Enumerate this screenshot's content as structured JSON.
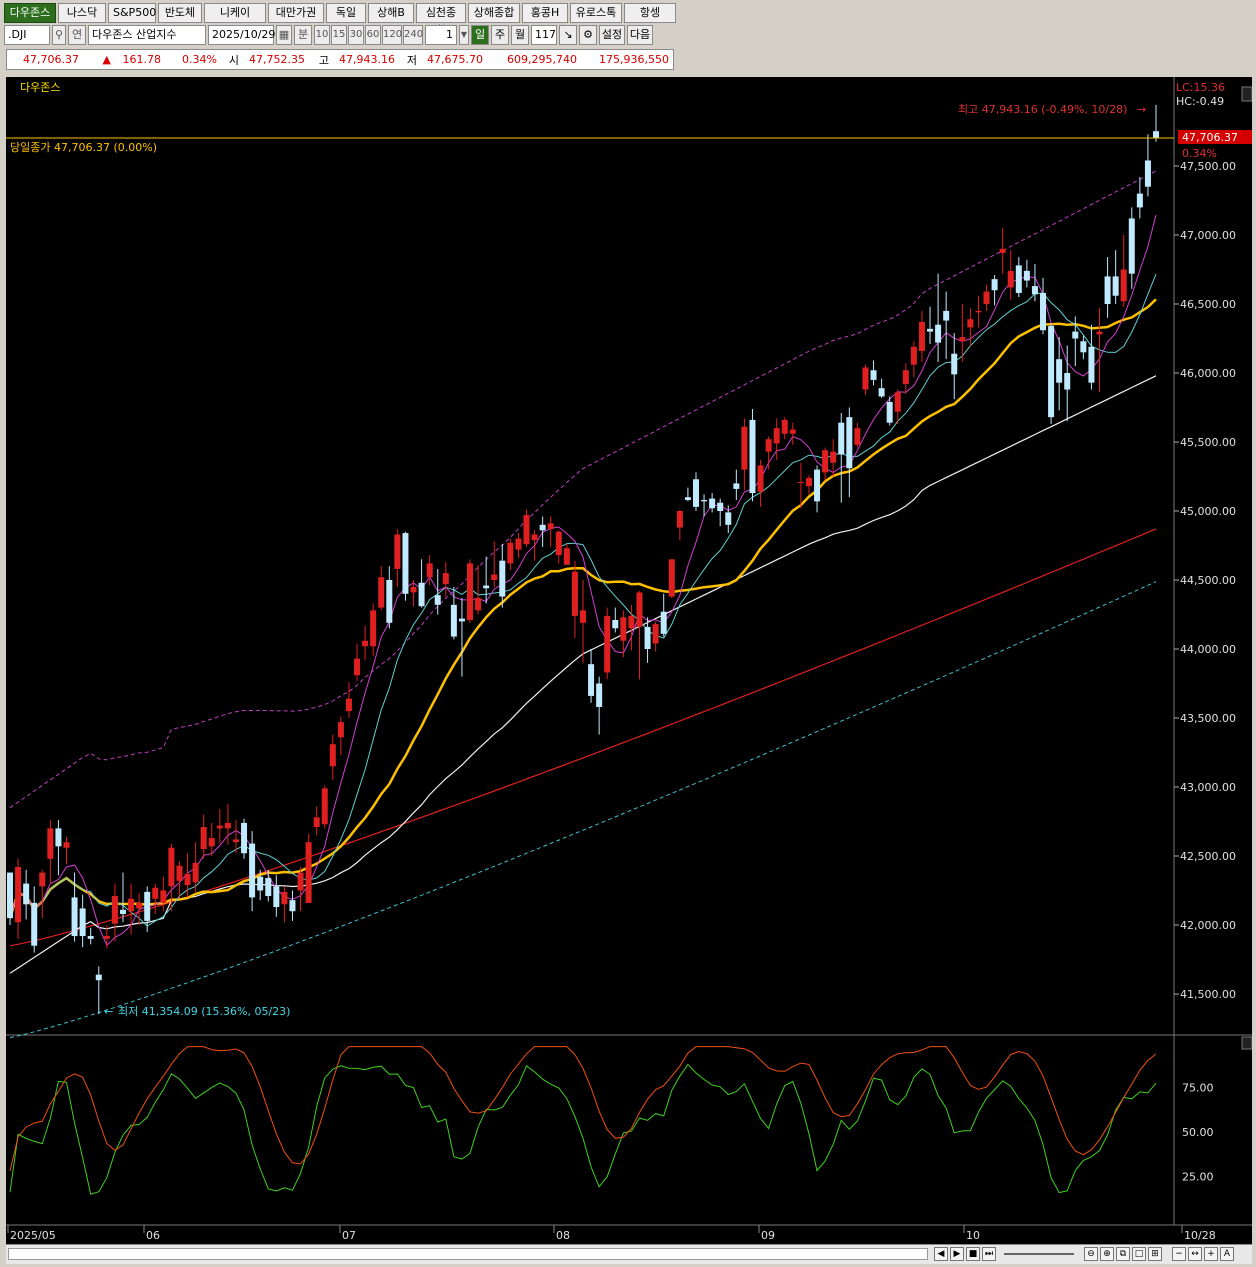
{
  "tabs": [
    "다우존스",
    "나스닥",
    "S&P500",
    "반도체",
    "니케이",
    "대만가권",
    "독일",
    "상해B",
    "심천종합",
    "상해종합",
    "홍콩H",
    "유로스톡",
    "항셍"
  ],
  "toolbar": {
    "code": ".DJI",
    "code_type": "연",
    "name": "다우존스 산업지수",
    "date": "2025/10/29",
    "period_unit": "분",
    "minute_options": [
      "10",
      "15",
      "30",
      "60",
      "120",
      "240"
    ],
    "count_value": "1",
    "day_btn": "일",
    "week_btn": "주",
    "month_btn": "월",
    "bars": "117",
    "settings": "설정",
    "next": "다음"
  },
  "quote": {
    "price": "47,706.37",
    "arrow": "▲",
    "change": "161.78",
    "pct": "0.34%",
    "open_label": "시",
    "open": "47,752.35",
    "high_label": "고",
    "high": "47,943.16",
    "low_label": "저",
    "low": "47,675.70",
    "volume": "609,295,740",
    "amount": "175,936,550"
  },
  "chart": {
    "title": "다우존스",
    "prev_close_label": "당일종가 47,706.37 (0.00%)",
    "max_label": "최고 47,943.16 (-0.49%, 10/28)",
    "min_label": "최저 41,354.09 (15.36%, 05/23)",
    "lc": "LC:15.36",
    "hc": "HC:-0.49",
    "price_box": "47,706.37",
    "price_box_pct": "0.34%",
    "y_ticks": [
      "47,500.00",
      "47,000.00",
      "46,500.00",
      "46,000.00",
      "45,500.00",
      "45,000.00",
      "44,500.00",
      "44,000.00",
      "43,500.00",
      "43,000.00",
      "42,500.00",
      "42,000.00",
      "41,500.00"
    ],
    "osc_ticks": [
      "75.00",
      "50.00",
      "25.00"
    ],
    "x_labels": [
      "2025/05",
      "06",
      "07",
      "08",
      "09",
      "10",
      "10/28"
    ]
  },
  "chart_data": {
    "type": "candlestick",
    "y_range": [
      41200,
      48000
    ],
    "osc_range": [
      0,
      100
    ],
    "candles": [
      [
        42380,
        42380,
        42000,
        42050
      ],
      [
        42020,
        42480,
        41900,
        42420
      ],
      [
        42300,
        42400,
        42040,
        42150
      ],
      [
        42160,
        42280,
        41800,
        41850
      ],
      [
        42280,
        42400,
        42050,
        42380
      ],
      [
        42480,
        42760,
        42300,
        42700
      ],
      [
        42700,
        42760,
        42360,
        42570
      ],
      [
        42560,
        42640,
        42440,
        42600
      ],
      [
        42200,
        42380,
        41880,
        41920
      ],
      [
        42120,
        42220,
        41840,
        41920
      ],
      [
        41920,
        41980,
        41860,
        41900
      ],
      [
        41640,
        41700,
        41354,
        41600
      ],
      [
        41900,
        42000,
        41830,
        41920
      ],
      [
        42010,
        42300,
        41880,
        42210
      ],
      [
        42110,
        42380,
        42020,
        42080
      ],
      [
        42100,
        42300,
        41930,
        42190
      ],
      [
        42120,
        42230,
        42000,
        42160
      ],
      [
        42240,
        42280,
        41950,
        42030
      ],
      [
        42190,
        42300,
        42080,
        42270
      ],
      [
        42160,
        42350,
        42100,
        42250
      ],
      [
        42280,
        42590,
        42100,
        42560
      ],
      [
        42320,
        42460,
        42190,
        42430
      ],
      [
        42290,
        42520,
        42200,
        42370
      ],
      [
        42310,
        42600,
        42240,
        42450
      ],
      [
        42550,
        42800,
        42480,
        42710
      ],
      [
        42570,
        42740,
        42500,
        42630
      ],
      [
        42700,
        42840,
        42590,
        42720
      ],
      [
        42700,
        42880,
        42580,
        42740
      ],
      [
        42600,
        42760,
        42520,
        42620
      ],
      [
        42740,
        42770,
        42480,
        42520
      ],
      [
        42590,
        42680,
        42100,
        42200
      ],
      [
        42350,
        42400,
        42180,
        42250
      ],
      [
        42340,
        42400,
        42170,
        42210
      ],
      [
        42280,
        42360,
        42060,
        42130
      ],
      [
        42150,
        42280,
        42020,
        42240
      ],
      [
        42180,
        42250,
        42030,
        42100
      ],
      [
        42250,
        42420,
        42100,
        42380
      ],
      [
        42160,
        42660,
        42160,
        42600
      ],
      [
        42710,
        42860,
        42650,
        42780
      ],
      [
        42730,
        43010,
        42700,
        42990
      ],
      [
        43150,
        43380,
        43050,
        43310
      ],
      [
        43360,
        43510,
        43230,
        43470
      ],
      [
        43550,
        43760,
        43500,
        43640
      ],
      [
        43810,
        44040,
        43770,
        43930
      ],
      [
        44020,
        44170,
        43920,
        44060
      ],
      [
        44020,
        44330,
        43950,
        44280
      ],
      [
        44300,
        44600,
        44280,
        44520
      ],
      [
        44500,
        44600,
        44150,
        44190
      ],
      [
        44580,
        44870,
        44450,
        44830
      ],
      [
        44840,
        44850,
        44350,
        44400
      ],
      [
        44410,
        44500,
        44310,
        44450
      ],
      [
        44480,
        44650,
        44300,
        44310
      ],
      [
        44520,
        44680,
        44460,
        44620
      ],
      [
        44390,
        44580,
        44250,
        44320
      ],
      [
        44470,
        44630,
        44380,
        44550
      ],
      [
        44320,
        44450,
        44070,
        44090
      ],
      [
        44220,
        44370,
        43800,
        44200
      ],
      [
        44210,
        44650,
        44190,
        44620
      ],
      [
        44280,
        44610,
        44250,
        44370
      ],
      [
        44460,
        44670,
        44330,
        44440
      ],
      [
        44500,
        44780,
        44450,
        44540
      ],
      [
        44640,
        44760,
        44300,
        44380
      ],
      [
        44620,
        44800,
        44570,
        44770
      ],
      [
        44720,
        44840,
        44660,
        44800
      ],
      [
        44760,
        45010,
        44740,
        44970
      ],
      [
        44790,
        44860,
        44640,
        44830
      ],
      [
        44900,
        44960,
        44740,
        44860
      ],
      [
        44870,
        44960,
        44740,
        44910
      ],
      [
        44680,
        44860,
        44620,
        44850
      ],
      [
        44610,
        44760,
        44660,
        44730
      ],
      [
        44240,
        44640,
        44080,
        44560
      ],
      [
        44190,
        44500,
        43900,
        44280
      ],
      [
        43890,
        44000,
        43610,
        43660
      ],
      [
        43750,
        43800,
        43380,
        43580
      ],
      [
        43830,
        44300,
        43780,
        44240
      ],
      [
        44210,
        44300,
        44120,
        44150
      ],
      [
        44060,
        44280,
        43940,
        44230
      ],
      [
        44150,
        44320,
        43990,
        44240
      ],
      [
        44160,
        44420,
        43780,
        44410
      ],
      [
        44160,
        44230,
        43900,
        44000
      ],
      [
        44040,
        44200,
        43980,
        44180
      ],
      [
        44270,
        44400,
        44090,
        44110
      ],
      [
        44380,
        44650,
        44370,
        44650
      ],
      [
        44880,
        45010,
        44790,
        45000
      ],
      [
        45100,
        45170,
        45070,
        45080
      ],
      [
        45230,
        45280,
        45000,
        45030
      ],
      [
        45080,
        45120,
        44960,
        45070
      ],
      [
        45090,
        45130,
        44990,
        45020
      ],
      [
        45060,
        45090,
        44890,
        45000
      ],
      [
        44990,
        45040,
        44840,
        44900
      ],
      [
        45200,
        45300,
        45080,
        45160
      ],
      [
        45300,
        45670,
        45150,
        45610
      ],
      [
        45660,
        45740,
        45070,
        45130
      ],
      [
        45140,
        45370,
        45030,
        45330
      ],
      [
        45430,
        45540,
        45300,
        45520
      ],
      [
        45490,
        45670,
        45370,
        45600
      ],
      [
        45560,
        45680,
        45520,
        45660
      ],
      [
        45560,
        45640,
        45480,
        45590
      ],
      [
        45210,
        45350,
        45020,
        45210
      ],
      [
        45180,
        45260,
        45120,
        45240
      ],
      [
        45300,
        45330,
        44990,
        45070
      ],
      [
        45280,
        45460,
        45220,
        45440
      ],
      [
        45350,
        45520,
        45250,
        45430
      ],
      [
        45640,
        45710,
        45060,
        45410
      ],
      [
        45680,
        45750,
        45100,
        45310
      ],
      [
        45480,
        45640,
        45460,
        45600
      ],
      [
        45880,
        46060,
        45840,
        46040
      ],
      [
        46020,
        46090,
        45910,
        45950
      ],
      [
        45890,
        45960,
        45820,
        45830
      ],
      [
        45790,
        45830,
        45620,
        45640
      ],
      [
        45720,
        45880,
        45630,
        45860
      ],
      [
        45920,
        46070,
        45850,
        46020
      ],
      [
        46060,
        46230,
        45970,
        46190
      ],
      [
        46160,
        46450,
        46080,
        46370
      ],
      [
        46320,
        46480,
        46210,
        46300
      ],
      [
        46350,
        46720,
        46080,
        46220
      ],
      [
        46450,
        46590,
        46100,
        46380
      ],
      [
        46140,
        46290,
        45810,
        45990
      ],
      [
        46230,
        46500,
        46080,
        46260
      ],
      [
        46330,
        46470,
        46190,
        46390
      ],
      [
        46440,
        46560,
        46330,
        46450
      ],
      [
        46500,
        46640,
        46450,
        46590
      ],
      [
        46680,
        46710,
        46490,
        46600
      ],
      [
        46870,
        47050,
        46720,
        46900
      ],
      [
        46620,
        46890,
        46530,
        46740
      ],
      [
        46780,
        46840,
        46550,
        46580
      ],
      [
        46740,
        46820,
        46620,
        46670
      ],
      [
        46630,
        46790,
        46520,
        46570
      ],
      [
        46580,
        46690,
        46280,
        46310
      ],
      [
        46340,
        46360,
        45630,
        45680
      ],
      [
        46100,
        46260,
        45730,
        45930
      ],
      [
        46000,
        46200,
        45650,
        45880
      ],
      [
        46300,
        46410,
        46050,
        46250
      ],
      [
        46230,
        46270,
        46100,
        46150
      ],
      [
        46190,
        46350,
        45880,
        45930
      ],
      [
        46280,
        46470,
        45860,
        46300
      ],
      [
        46700,
        46840,
        46400,
        46500
      ],
      [
        46700,
        46890,
        46500,
        46560
      ],
      [
        46520,
        47000,
        46480,
        46750
      ],
      [
        47120,
        47200,
        46610,
        46720
      ],
      [
        47300,
        47420,
        47120,
        47200
      ],
      [
        47540,
        47730,
        47280,
        47350
      ],
      [
        47752,
        47943,
        47676,
        47706
      ]
    ],
    "legend": "none"
  }
}
